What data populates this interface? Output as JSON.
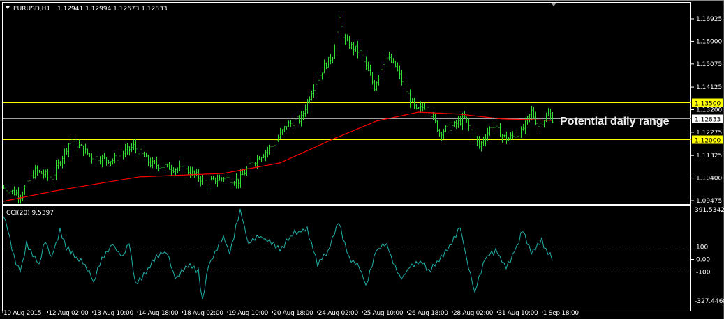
{
  "header": {
    "symbol": "EURUSD,H1",
    "ohlc": "1.12941 1.12994 1.12673 1.12833"
  },
  "annotation": "Potential daily range",
  "colors": {
    "bars": "#32dc32",
    "ma": "#ff0000",
    "cci": "#20b2aa",
    "level": "#ffff00",
    "frame": "#ffffff",
    "current": "#a0a0a0"
  },
  "price_axis": {
    "min": 1.09475,
    "max": 1.16925,
    "ticks": [
      "1.16925",
      "1.16000",
      "1.15075",
      "1.14125",
      "1.13200",
      "1.12275",
      "1.11325",
      "1.10400",
      "1.09475"
    ],
    "levels": [
      {
        "value": 1.135,
        "label": "1.13500"
      },
      {
        "value": 1.12,
        "label": "1.12000"
      }
    ],
    "current": {
      "value": 1.12833,
      "label": "1.12833"
    }
  },
  "indicator": {
    "title": "CCI(20) 9.5397",
    "max": 391.5342,
    "min": -327.4468,
    "max_label": "391.5342",
    "min_label": "-327.4468",
    "ticks": [
      {
        "value": 100,
        "label": "100"
      },
      {
        "value": 0,
        "label": "0.00"
      },
      {
        "value": -100,
        "label": "-100"
      }
    ]
  },
  "time_axis": [
    "10 Aug 2015",
    "12 Aug 02:00",
    "13 Aug 10:00",
    "14 Aug 18:00",
    "18 Aug 02:00",
    "19 Aug 10:00",
    "20 Aug 18:00",
    "24 Aug 02:00",
    "25 Aug 10:00",
    "26 Aug 18:00",
    "28 Aug 02:00",
    "31 Aug 10:00",
    "1 Sep 18:00"
  ],
  "chart_data": {
    "type": "line",
    "bar_count": 263,
    "close_path": [
      [
        0,
        1.0999
      ],
      [
        8,
        1.097
      ],
      [
        15,
        1.107
      ],
      [
        23,
        1.1042
      ],
      [
        32,
        1.1199
      ],
      [
        42,
        1.1127
      ],
      [
        52,
        1.1113
      ],
      [
        62,
        1.117
      ],
      [
        70,
        1.1099
      ],
      [
        78,
        1.1085
      ],
      [
        88,
        1.107
      ],
      [
        97,
        1.1022
      ],
      [
        105,
        1.1042
      ],
      [
        112,
        1.1028
      ],
      [
        118,
        1.1099
      ],
      [
        128,
        1.117
      ],
      [
        135,
        1.1256
      ],
      [
        142,
        1.1285
      ],
      [
        147,
        1.1398
      ],
      [
        153,
        1.1498
      ],
      [
        157,
        1.1541
      ],
      [
        160,
        1.1684
      ],
      [
        163,
        1.1598
      ],
      [
        170,
        1.1555
      ],
      [
        177,
        1.1413
      ],
      [
        182,
        1.1541
      ],
      [
        187,
        1.1498
      ],
      [
        192,
        1.1398
      ],
      [
        197,
        1.1313
      ],
      [
        202,
        1.1341
      ],
      [
        208,
        1.1227
      ],
      [
        215,
        1.1256
      ],
      [
        220,
        1.1285
      ],
      [
        227,
        1.117
      ],
      [
        233,
        1.1256
      ],
      [
        240,
        1.1199
      ],
      [
        247,
        1.1227
      ],
      [
        252,
        1.1313
      ],
      [
        255,
        1.1256
      ],
      [
        260,
        1.1299
      ],
      [
        262,
        1.1283
      ]
    ],
    "ma_path": [
      [
        0,
        1.0945
      ],
      [
        25,
        1.0988
      ],
      [
        65,
        1.1045
      ],
      [
        105,
        1.1059
      ],
      [
        132,
        1.1102
      ],
      [
        158,
        1.1202
      ],
      [
        178,
        1.1273
      ],
      [
        198,
        1.131
      ],
      [
        218,
        1.1302
      ],
      [
        238,
        1.1282
      ],
      [
        262,
        1.1276
      ]
    ],
    "cci_path": [
      [
        0,
        338
      ],
      [
        2,
        229
      ],
      [
        5,
        11
      ],
      [
        8,
        -98
      ],
      [
        11,
        120
      ],
      [
        13,
        65
      ],
      [
        17,
        -44
      ],
      [
        20,
        147
      ],
      [
        23,
        11
      ],
      [
        27,
        229
      ],
      [
        30,
        93
      ],
      [
        35,
        11
      ],
      [
        40,
        -71
      ],
      [
        43,
        -180
      ],
      [
        47,
        11
      ],
      [
        52,
        120
      ],
      [
        57,
        11
      ],
      [
        60,
        120
      ],
      [
        63,
        -207
      ],
      [
        68,
        -98
      ],
      [
        73,
        11
      ],
      [
        78,
        65
      ],
      [
        82,
        -153
      ],
      [
        88,
        -44
      ],
      [
        93,
        -98
      ],
      [
        95,
        -316
      ],
      [
        98,
        -44
      ],
      [
        105,
        174
      ],
      [
        108,
        38
      ],
      [
        113,
        392
      ],
      [
        117,
        120
      ],
      [
        122,
        174
      ],
      [
        127,
        147
      ],
      [
        132,
        65
      ],
      [
        138,
        202
      ],
      [
        145,
        229
      ],
      [
        150,
        -44
      ],
      [
        155,
        65
      ],
      [
        160,
        283
      ],
      [
        165,
        11
      ],
      [
        170,
        -71
      ],
      [
        173,
        -207
      ],
      [
        178,
        65
      ],
      [
        183,
        120
      ],
      [
        187,
        -71
      ],
      [
        190,
        -153
      ],
      [
        195,
        -44
      ],
      [
        200,
        -16
      ],
      [
        203,
        -98
      ],
      [
        208,
        -16
      ],
      [
        213,
        93
      ],
      [
        218,
        256
      ],
      [
        222,
        -71
      ],
      [
        225,
        -261
      ],
      [
        230,
        11
      ],
      [
        235,
        65
      ],
      [
        240,
        -71
      ],
      [
        245,
        93
      ],
      [
        248,
        229
      ],
      [
        252,
        38
      ],
      [
        257,
        147
      ],
      [
        258,
        93
      ],
      [
        262,
        9.54
      ]
    ]
  }
}
